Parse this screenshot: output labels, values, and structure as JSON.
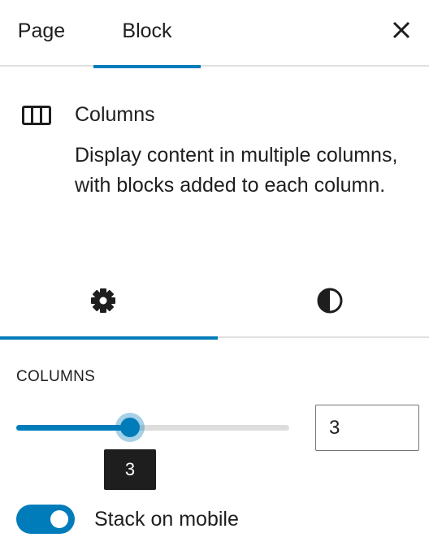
{
  "top_tabs": [
    {
      "label": "Page",
      "active": false
    },
    {
      "label": "Block",
      "active": true
    }
  ],
  "icons": {
    "close": "close-icon",
    "block": "columns-block-icon",
    "settings_tab": "gear-icon",
    "styles_tab": "contrast-icon"
  },
  "block_card": {
    "title": "Columns",
    "description": "Display content in multiple columns, with blocks added to each column."
  },
  "inspector_tabs": {
    "active": "settings"
  },
  "columns_panel": {
    "heading": "COLUMNS",
    "slider": {
      "min": 1,
      "max": 6,
      "value": 3,
      "tooltip": "3"
    },
    "number_input_value": "3",
    "stack_on_mobile": {
      "label": "Stack on mobile",
      "checked": true
    }
  },
  "colors": {
    "accent": "#007cba",
    "text": "#1e1e1e",
    "divider": "#e0e0e0",
    "tooltip_bg": "#1e1e1e"
  }
}
